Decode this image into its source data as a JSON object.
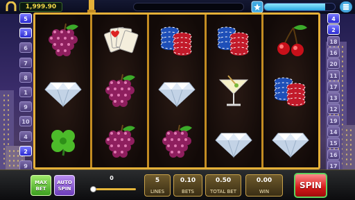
{
  "header": {
    "balance": "1,999.90",
    "level_progress": 0.86
  },
  "reels": [
    [
      "grapes",
      "diamond",
      "clover"
    ],
    [
      "playing-cards",
      "grapes",
      "grapes"
    ],
    [
      "casino-chips",
      "diamond",
      "grapes"
    ],
    [
      "casino-chips",
      "martini",
      "diamond"
    ],
    [
      "cherries",
      "casino-chips",
      "diamond"
    ]
  ],
  "paylines": {
    "left": [
      "5",
      "3",
      "6",
      "7",
      "8",
      "1",
      "9",
      "10",
      "4",
      "2",
      "9"
    ],
    "right": [
      "4",
      "2",
      "18",
      "16",
      "20",
      "11",
      "17",
      "13",
      "12",
      "19",
      "14",
      "15",
      "16",
      "17"
    ]
  },
  "controls": {
    "max_bet_line1": "MAX",
    "max_bet_line2": "BET",
    "auto_spin_line1": "AUTO",
    "auto_spin_line2": "SPIN",
    "slider_value": "0",
    "lines_value": "5",
    "lines_label": "LINES",
    "bets_value": "0.10",
    "bets_label": "BETS",
    "total_bet_value": "0.50",
    "total_bet_label": "TOTAL BET",
    "win_value": "0.00",
    "win_label": "WIN",
    "spin_label": "SPIN"
  },
  "colors": {
    "frame": "#e5b038",
    "spin": "#d41818",
    "max_bet": "#3a9e1e",
    "auto_spin": "#6a3cb8"
  }
}
